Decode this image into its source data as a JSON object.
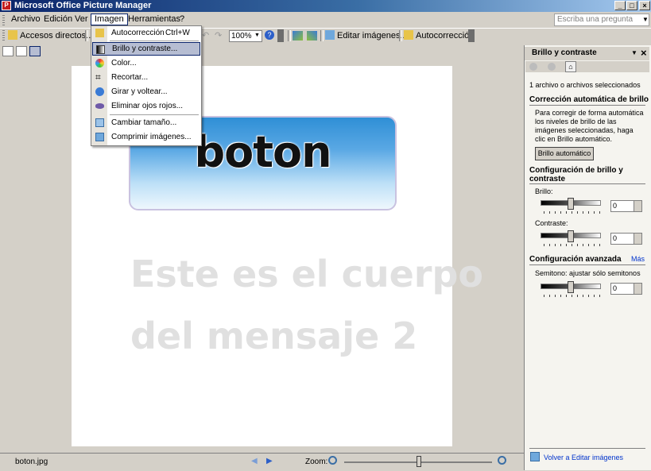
{
  "window": {
    "title": "Microsoft Office Picture Manager",
    "app_icon_glyph": "P"
  },
  "window_controls": {
    "minimize": "_",
    "maximize": "□",
    "close": "×"
  },
  "menubar": {
    "items": [
      "Archivo",
      "Edición",
      "Ver",
      "Imagen",
      "Herramientas",
      "?"
    ],
    "help_placeholder": "Escriba una pregunta"
  },
  "toolbar": {
    "shortcuts_label": "Accesos directos...",
    "zoom_value": "100%",
    "edit_images_label": "Editar imágenes...",
    "autocorrect_label": "Autocorrección"
  },
  "image_menu": {
    "items": [
      {
        "label": "Autocorrección",
        "shortcut": "Ctrl+W",
        "icon": "autocorrect-icon"
      },
      {
        "label": "Brillo y contraste...",
        "shortcut": "",
        "icon": "brightness-icon"
      },
      {
        "label": "Color...",
        "shortcut": "",
        "icon": "color-icon"
      },
      {
        "label": "Recortar...",
        "shortcut": "",
        "icon": "crop-icon"
      },
      {
        "label": "Girar y voltear...",
        "shortcut": "",
        "icon": "rotate-icon"
      },
      {
        "label": "Eliminar ojos rojos...",
        "shortcut": "",
        "icon": "red-eye-icon"
      },
      {
        "label": "Cambiar tamaño...",
        "shortcut": "",
        "icon": "resize-icon"
      },
      {
        "label": "Comprimir imágenes...",
        "shortcut": "",
        "icon": "compress-icon"
      }
    ]
  },
  "image": {
    "button_text": "boton",
    "body_line1": "Este es el cuerpo",
    "body_line2": "del mensaje 2"
  },
  "pane": {
    "title": "Brillo y contraste",
    "dropdown_glyph": "▼",
    "close_glyph": "×",
    "selected_count": "1 archivo o archivos seleccionados",
    "auto_heading": "Corrección automática de brillo",
    "auto_desc": "Para corregir de forma automática los niveles de brillo de las imágenes seleccionadas, haga clic en Brillo automático.",
    "auto_button": "Brillo automático",
    "config_heading": "Configuración de brillo y contraste",
    "brightness_label": "Brillo:",
    "brightness_value": "0",
    "contrast_label": "Contraste:",
    "contrast_value": "0",
    "advanced_heading": "Configuración avanzada",
    "more_link": "Más",
    "midtones_label": "Semitono: ajustar sólo semitonos",
    "midtones_value": "0",
    "back_link": "Volver a Editar imágenes"
  },
  "statusbar": {
    "filename": "boton.jpg",
    "zoom_label": "Zoom:"
  }
}
